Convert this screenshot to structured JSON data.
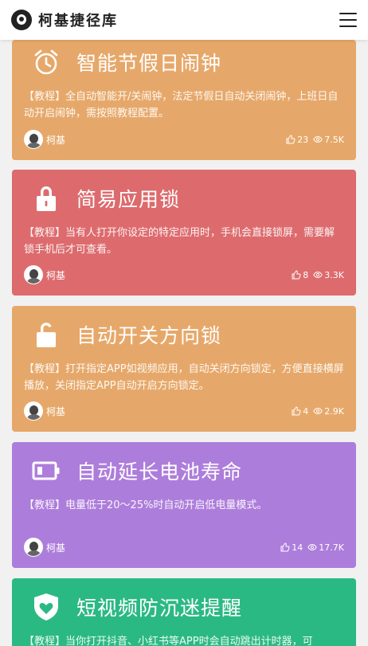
{
  "header": {
    "brand": "柯基捷径库"
  },
  "cards": [
    {
      "title": "智能节假日闹钟",
      "desc": "【教程】全自动智能开/关闹钟，法定节假日自动关闭闹钟，上班日自动开启闹钟，需按照教程配置。",
      "author": "柯基",
      "likes": "23",
      "views": "7.5K",
      "icon": "alarm-clock-icon",
      "color": "#e6a86a"
    },
    {
      "title": "简易应用锁",
      "desc": "【教程】当有人打开你设定的特定应用时，手机会直接锁屏，需要解锁手机后才可查看。",
      "author": "柯基",
      "likes": "8",
      "views": "3.3K",
      "icon": "lock-icon",
      "color": "#dd6b6d"
    },
    {
      "title": "自动开关方向锁",
      "desc": "【教程】打开指定APP如视频应用，自动关闭方向锁定，方便直接横屏播放，关闭指定APP自动开启方向锁定。",
      "author": "柯基",
      "likes": "4",
      "views": "2.9K",
      "icon": "unlock-icon",
      "color": "#e6a86a"
    },
    {
      "title": "自动延长电池寿命",
      "desc": "【教程】电量低于20～25%时自动开启低电量模式。",
      "author": "柯基",
      "likes": "14",
      "views": "17.7K",
      "icon": "battery-icon",
      "color": "#ad7ddb"
    },
    {
      "title": "短视频防沉迷提醒",
      "desc": "【教程】当你打开抖音、小红书等APP时会自动跳出计时器，可",
      "author": "",
      "likes": "",
      "views": "",
      "icon": "shield-heart-icon",
      "color": "#2bb983"
    }
  ]
}
